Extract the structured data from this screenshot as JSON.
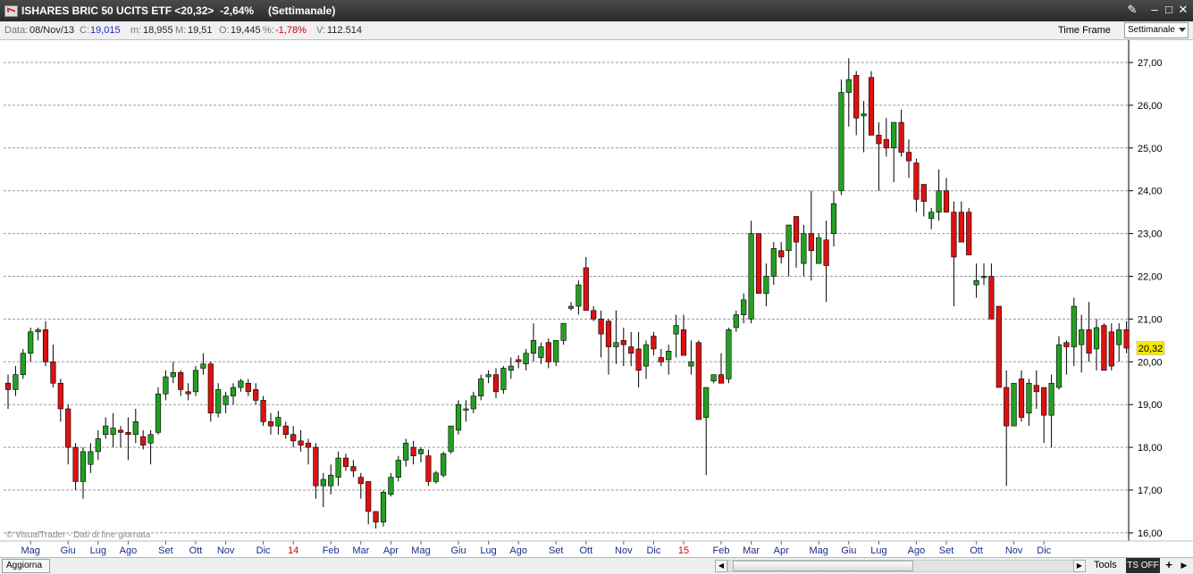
{
  "window": {
    "title": "ISHARES BRIC 50 UCITS ETF <20,32>  -2,64%",
    "mode": "(Settimanale)",
    "buttons": {
      "tools_icon": "✎",
      "minimize": "‒",
      "maximize": "□",
      "close": "✕"
    }
  },
  "infobar": {
    "date_label": "Data:",
    "date_value": "08/Nov/13",
    "close_label": "C:",
    "close_value": "19,015",
    "min_label": "m:",
    "min_value": "18,955",
    "max_label": "M:",
    "max_value": "19,51",
    "open_label": "O:",
    "open_value": "19,445",
    "pct_label": "%:",
    "pct_value": "-1,78%",
    "vol_label": "V:",
    "vol_value": "112.514",
    "timeframe_label": "Time Frame",
    "timeframe_value": "Settimanale"
  },
  "watermark": "© VisualTrader - Dati di fine giornata",
  "bottombar": {
    "refresh": "Aggiorna",
    "tools": "Tools",
    "ts": "TS OFF",
    "plus": "+",
    "left_arrow": "◀",
    "right_arrow": "▶"
  },
  "colors": {
    "up": "#23a023",
    "down": "#dd1111",
    "grid": "#9a9a9a",
    "price_tag_bg": "#f8e800",
    "month_label": "#1a2c8c",
    "year_label": "#d40000"
  },
  "chart_data": {
    "type": "candlestick",
    "title": "ISHARES BRIC 50 UCITS ETF",
    "timeframe": "weekly",
    "ylim": [
      16.0,
      27.0
    ],
    "yticks": [
      "27,00",
      "26,00",
      "25,00",
      "24,00",
      "23,00",
      "22,00",
      "21,00",
      "20,00",
      "19,00",
      "18,00",
      "17,00",
      "16,00"
    ],
    "last_price": "20,32",
    "xticks": [
      {
        "label": "Mag",
        "i": 3
      },
      {
        "label": "Giu",
        "i": 8
      },
      {
        "label": "Lug",
        "i": 12
      },
      {
        "label": "Ago",
        "i": 16
      },
      {
        "label": "Set",
        "i": 21
      },
      {
        "label": "Ott",
        "i": 25
      },
      {
        "label": "Nov",
        "i": 29
      },
      {
        "label": "Dic",
        "i": 34
      },
      {
        "label": "14",
        "i": 38,
        "year": true
      },
      {
        "label": "Feb",
        "i": 43
      },
      {
        "label": "Mar",
        "i": 47
      },
      {
        "label": "Apr",
        "i": 51
      },
      {
        "label": "Mag",
        "i": 55
      },
      {
        "label": "Giu",
        "i": 60
      },
      {
        "label": "Lug",
        "i": 64
      },
      {
        "label": "Ago",
        "i": 68
      },
      {
        "label": "Set",
        "i": 73
      },
      {
        "label": "Ott",
        "i": 77
      },
      {
        "label": "Nov",
        "i": 82
      },
      {
        "label": "Dic",
        "i": 86
      },
      {
        "label": "15",
        "i": 90,
        "year": true
      },
      {
        "label": "Feb",
        "i": 95
      },
      {
        "label": "Mar",
        "i": 99
      },
      {
        "label": "Apr",
        "i": 103
      },
      {
        "label": "Mag",
        "i": 108
      },
      {
        "label": "Giu",
        "i": 112
      },
      {
        "label": "Lug",
        "i": 116
      },
      {
        "label": "Ago",
        "i": 121
      },
      {
        "label": "Set",
        "i": 125
      },
      {
        "label": "Ott",
        "i": 129
      },
      {
        "label": "Nov",
        "i": 134
      },
      {
        "label": "Dic",
        "i": 138
      }
    ],
    "candles": [
      [
        19.5,
        19.7,
        18.9,
        19.35
      ],
      [
        19.35,
        19.9,
        19.2,
        19.7
      ],
      [
        19.7,
        20.3,
        19.6,
        20.2
      ],
      [
        20.2,
        20.8,
        20.0,
        20.7
      ],
      [
        20.7,
        20.8,
        20.5,
        20.75
      ],
      [
        20.75,
        20.95,
        19.9,
        20.0
      ],
      [
        20.0,
        20.4,
        19.4,
        19.5
      ],
      [
        19.5,
        19.6,
        18.6,
        18.9
      ],
      [
        18.9,
        19.0,
        17.6,
        18.0
      ],
      [
        18.0,
        18.1,
        17.0,
        17.2
      ],
      [
        17.2,
        18.0,
        16.8,
        17.9
      ],
      [
        17.6,
        18.1,
        17.4,
        17.9
      ],
      [
        17.9,
        18.4,
        17.7,
        18.2
      ],
      [
        18.3,
        18.7,
        18.2,
        18.5
      ],
      [
        18.3,
        18.8,
        18.0,
        18.45
      ],
      [
        18.4,
        18.5,
        18.0,
        18.35
      ],
      [
        18.35,
        18.7,
        17.7,
        18.3
      ],
      [
        18.3,
        18.9,
        18.1,
        18.6
      ],
      [
        18.25,
        18.4,
        17.95,
        18.05
      ],
      [
        18.1,
        18.4,
        17.6,
        18.3
      ],
      [
        18.35,
        19.4,
        18.3,
        19.25
      ],
      [
        19.25,
        19.8,
        19.1,
        19.65
      ],
      [
        19.65,
        20.0,
        19.5,
        19.75
      ],
      [
        19.75,
        19.8,
        19.2,
        19.35
      ],
      [
        19.3,
        19.5,
        19.1,
        19.25
      ],
      [
        19.3,
        19.9,
        19.2,
        19.8
      ],
      [
        19.85,
        20.2,
        19.7,
        19.95
      ],
      [
        19.95,
        20.0,
        18.6,
        18.8
      ],
      [
        18.8,
        19.5,
        18.7,
        19.35
      ],
      [
        19.0,
        19.3,
        18.8,
        19.2
      ],
      [
        19.2,
        19.5,
        19.0,
        19.4
      ],
      [
        19.4,
        19.6,
        19.3,
        19.55
      ],
      [
        19.5,
        19.6,
        19.2,
        19.3
      ],
      [
        19.35,
        19.5,
        19.0,
        19.1
      ],
      [
        19.1,
        19.2,
        18.5,
        18.6
      ],
      [
        18.6,
        18.8,
        18.3,
        18.5
      ],
      [
        18.5,
        18.85,
        18.3,
        18.7
      ],
      [
        18.5,
        18.6,
        18.2,
        18.3
      ],
      [
        18.3,
        18.5,
        18.0,
        18.15
      ],
      [
        18.15,
        18.4,
        17.9,
        18.05
      ],
      [
        18.1,
        18.2,
        17.6,
        18.0
      ],
      [
        18.0,
        18.1,
        16.8,
        17.1
      ],
      [
        17.1,
        17.4,
        16.6,
        17.25
      ],
      [
        17.1,
        17.6,
        16.9,
        17.35
      ],
      [
        17.3,
        17.9,
        17.1,
        17.75
      ],
      [
        17.75,
        17.85,
        17.45,
        17.55
      ],
      [
        17.55,
        17.7,
        17.3,
        17.45
      ],
      [
        17.3,
        17.4,
        16.8,
        17.15
      ],
      [
        17.2,
        17.2,
        16.2,
        16.5
      ],
      [
        16.5,
        16.2,
        16.1,
        16.25
      ],
      [
        16.25,
        17.0,
        16.15,
        16.95
      ],
      [
        16.9,
        17.4,
        16.85,
        17.3
      ],
      [
        17.3,
        17.8,
        17.2,
        17.7
      ],
      [
        17.7,
        18.2,
        17.55,
        18.1
      ],
      [
        18.0,
        18.15,
        17.6,
        17.8
      ],
      [
        17.85,
        18.0,
        17.65,
        17.95
      ],
      [
        17.8,
        17.95,
        17.1,
        17.2
      ],
      [
        17.2,
        17.45,
        17.15,
        17.4
      ],
      [
        17.35,
        17.9,
        17.3,
        17.85
      ],
      [
        17.9,
        18.3,
        17.85,
        18.5
      ],
      [
        18.4,
        19.1,
        18.3,
        19.0
      ],
      [
        18.9,
        19.1,
        18.6,
        18.9
      ],
      [
        18.9,
        19.3,
        18.8,
        19.2
      ],
      [
        19.2,
        19.7,
        19.1,
        19.6
      ],
      [
        19.65,
        19.8,
        19.5,
        19.7
      ],
      [
        19.7,
        19.85,
        19.15,
        19.3
      ],
      [
        19.35,
        19.9,
        19.25,
        19.85
      ],
      [
        19.8,
        20.1,
        19.6,
        19.9
      ],
      [
        20.05,
        20.15,
        19.85,
        20.0
      ],
      [
        19.95,
        20.3,
        19.8,
        20.2
      ],
      [
        20.2,
        20.9,
        20.0,
        20.5
      ],
      [
        20.1,
        20.45,
        19.95,
        20.35
      ],
      [
        20.45,
        20.55,
        19.85,
        20.0
      ],
      [
        20.0,
        20.5,
        19.9,
        20.5
      ],
      [
        20.5,
        20.9,
        20.4,
        20.9
      ],
      [
        21.25,
        21.4,
        21.2,
        21.3
      ],
      [
        21.3,
        21.9,
        21.1,
        21.8
      ],
      [
        22.2,
        22.45,
        21.25,
        21.2
      ],
      [
        21.2,
        21.3,
        20.95,
        21.0
      ],
      [
        21.0,
        21.2,
        20.1,
        20.65
      ],
      [
        20.95,
        21.0,
        19.7,
        20.35
      ],
      [
        20.35,
        21.2,
        19.95,
        20.45
      ],
      [
        20.5,
        20.8,
        19.9,
        20.4
      ],
      [
        20.35,
        20.7,
        19.9,
        20.2
      ],
      [
        20.3,
        20.7,
        19.4,
        19.8
      ],
      [
        19.9,
        20.5,
        19.6,
        20.4
      ],
      [
        20.6,
        20.7,
        20.15,
        20.3
      ],
      [
        20.1,
        20.3,
        19.9,
        20.0
      ],
      [
        20.05,
        20.4,
        19.7,
        20.25
      ],
      [
        20.65,
        21.1,
        20.1,
        20.85
      ],
      [
        20.75,
        21.1,
        20.3,
        20.15
      ],
      [
        19.9,
        20.5,
        19.7,
        20.0
      ],
      [
        20.45,
        20.5,
        18.7,
        18.65
      ],
      [
        18.7,
        19.4,
        17.35,
        19.4
      ],
      [
        19.55,
        19.7,
        19.5,
        19.7
      ],
      [
        19.7,
        20.2,
        19.5,
        19.5
      ],
      [
        19.6,
        20.8,
        19.5,
        20.75
      ],
      [
        20.8,
        21.2,
        20.7,
        21.1
      ],
      [
        21.1,
        21.6,
        20.9,
        21.45
      ],
      [
        21.0,
        23.3,
        20.9,
        23.0
      ],
      [
        23.0,
        23.0,
        21.6,
        21.6
      ],
      [
        21.6,
        22.3,
        21.3,
        22.0
      ],
      [
        22.0,
        22.8,
        21.8,
        22.65
      ],
      [
        22.6,
        22.8,
        22.3,
        22.45
      ],
      [
        22.6,
        23.2,
        22.0,
        23.2
      ],
      [
        23.4,
        23.4,
        22.2,
        22.8
      ],
      [
        22.3,
        23.2,
        22.0,
        23.0
      ],
      [
        23.0,
        24.0,
        21.9,
        22.6
      ],
      [
        22.3,
        23.0,
        22.6,
        22.9
      ],
      [
        22.85,
        23.3,
        21.4,
        22.25
      ],
      [
        23.0,
        24.0,
        22.7,
        23.7
      ],
      [
        24.0,
        26.6,
        23.9,
        26.3
      ],
      [
        26.3,
        27.1,
        25.5,
        26.6
      ],
      [
        26.7,
        26.8,
        25.3,
        25.7
      ],
      [
        25.75,
        26.1,
        24.9,
        25.8
      ],
      [
        26.65,
        26.8,
        26.0,
        25.3
      ],
      [
        25.3,
        25.6,
        24.0,
        25.1
      ],
      [
        25.2,
        25.7,
        24.8,
        25.0
      ],
      [
        25.0,
        25.6,
        24.2,
        25.6
      ],
      [
        25.6,
        25.9,
        24.8,
        24.9
      ],
      [
        24.9,
        25.2,
        24.3,
        24.7
      ],
      [
        24.65,
        24.75,
        23.5,
        23.8
      ],
      [
        24.15,
        24.0,
        23.4,
        23.75
      ],
      [
        23.35,
        23.6,
        23.1,
        23.5
      ],
      [
        23.5,
        24.5,
        23.3,
        24.0
      ],
      [
        24.0,
        24.3,
        23.5,
        23.5
      ],
      [
        23.5,
        23.75,
        21.3,
        22.45
      ],
      [
        23.5,
        23.75,
        22.8,
        22.8
      ],
      [
        23.5,
        23.6,
        22.5,
        22.5
      ],
      [
        21.8,
        22.3,
        21.5,
        21.9
      ],
      [
        22.0,
        22.3,
        21.8,
        22.0
      ],
      [
        22.0,
        22.3,
        21.2,
        21.0
      ],
      [
        21.3,
        21.3,
        19.4,
        19.4
      ],
      [
        19.4,
        19.8,
        17.1,
        18.5
      ],
      [
        18.5,
        19.3,
        18.5,
        19.5
      ],
      [
        19.6,
        19.8,
        18.6,
        18.7
      ],
      [
        18.8,
        19.6,
        18.5,
        19.5
      ],
      [
        19.45,
        19.8,
        18.9,
        19.3
      ],
      [
        19.4,
        19.3,
        18.1,
        18.75
      ],
      [
        18.75,
        19.7,
        18.0,
        19.5
      ],
      [
        19.4,
        20.6,
        19.35,
        20.4
      ],
      [
        20.45,
        20.5,
        19.7,
        20.35
      ],
      [
        20.35,
        21.5,
        19.9,
        21.3
      ],
      [
        20.4,
        21.1,
        19.75,
        20.75
      ],
      [
        20.75,
        21.4,
        20.0,
        20.2
      ],
      [
        20.3,
        21.0,
        19.8,
        20.8
      ],
      [
        20.85,
        20.9,
        19.8,
        19.8
      ],
      [
        20.7,
        20.9,
        19.8,
        19.9
      ],
      [
        20.4,
        20.9,
        20.0,
        20.75
      ],
      [
        20.75,
        20.95,
        20.2,
        20.32
      ]
    ]
  }
}
